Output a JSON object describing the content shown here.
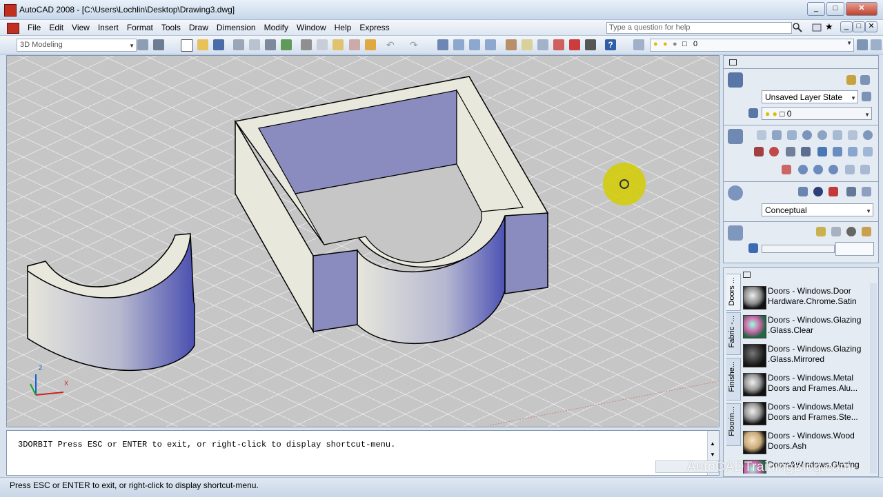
{
  "window": {
    "title": "AutoCAD 2008 - [C:\\Users\\Lochlin\\Desktop\\Drawing3.dwg]",
    "controls": [
      "_",
      "□",
      "✕"
    ],
    "doc_controls": [
      "_",
      "□",
      "✕"
    ]
  },
  "menu": {
    "items": [
      "File",
      "Edit",
      "View",
      "Insert",
      "Format",
      "Tools",
      "Draw",
      "Dimension",
      "Modify",
      "Window",
      "Help",
      "Express"
    ],
    "help_placeholder": "Type a question for help"
  },
  "toolbar": {
    "workspace": "3D Modeling",
    "layer_value": "0"
  },
  "command": {
    "history": "3DORBIT Press ESC or ENTER to exit, or right-click to display shortcut-menu.",
    "status": "Press ESC or ENTER to exit, or right-click to display shortcut-menu."
  },
  "dashboard": {
    "layer_state": "Unsaved Layer State",
    "layer_value": "0",
    "visual_style": "Conceptual"
  },
  "palette": {
    "tabs": [
      "Doors ...",
      "Fabric -...",
      "Finishe...",
      "Floorin..."
    ],
    "items": [
      {
        "line1": "Doors - Windows.Door",
        "line2": "Hardware.Chrome.Satin",
        "swatch": "chrome"
      },
      {
        "line1": "Doors - Windows.Glazing",
        "line2": ".Glass.Clear",
        "swatch": "glass"
      },
      {
        "line1": "Doors - Windows.Glazing",
        "line2": ".Glass.Mirrored",
        "swatch": "mirror"
      },
      {
        "line1": "Doors - Windows.Metal",
        "line2": "Doors and Frames.Alu...",
        "swatch": "metal"
      },
      {
        "line1": "Doors - Windows.Metal",
        "line2": "Doors and Frames.Ste...",
        "swatch": "metal"
      },
      {
        "line1": "Doors - Windows.Wood",
        "line2": "Doors.Ash",
        "swatch": "wood"
      },
      {
        "line1": "Doors&Windows.Glazing",
        "line2": "",
        "swatch": "glass"
      }
    ]
  },
  "watermark": "AutoCADTrainingBlog.com",
  "colors": {
    "face_blue": "#8a8cc0",
    "face_light": "#e8e8dc",
    "grid": "#c6c6c6",
    "accent": "#d2cd00"
  }
}
